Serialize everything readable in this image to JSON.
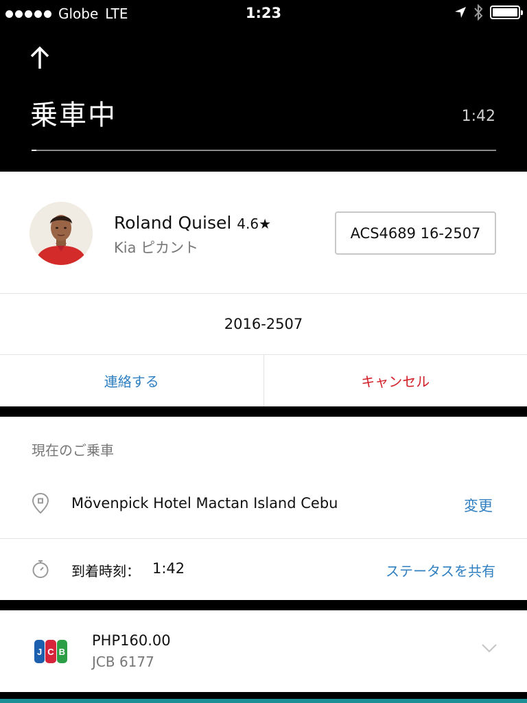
{
  "status_bar": {
    "carrier": "Globe",
    "network": "LTE",
    "time": "1:23"
  },
  "header": {
    "title": "乗車中",
    "eta": "1:42",
    "progress": 0.01
  },
  "driver": {
    "name": "Roland Quisel",
    "rating": "4.6★",
    "car": "Kia ピカント",
    "plate": "ACS4689 16-2507"
  },
  "plate_number": "2016-2507",
  "actions": {
    "contact": "連絡する",
    "cancel": "キャンセル"
  },
  "current_ride": {
    "section_title": "現在のご乗車",
    "destination": "Mövenpick Hotel Mactan Island Cebu",
    "change_label": "変更",
    "arrival_label": "到着時刻：",
    "arrival_time": "1:42",
    "share_label": "ステータスを共有"
  },
  "payment": {
    "brand_letters": [
      "J",
      "C",
      "B"
    ],
    "amount": "PHP160.00",
    "card": "JCB 6177"
  },
  "colors": {
    "link_blue": "#2f7fc1",
    "cancel_red": "#d31f28",
    "bottom_strip": "#1d8f96"
  }
}
